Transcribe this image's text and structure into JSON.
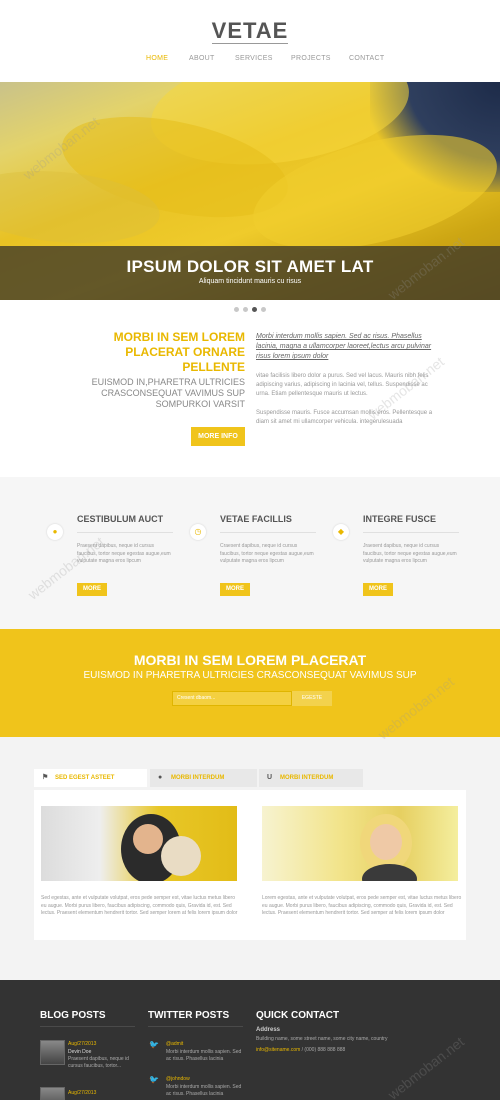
{
  "header": {
    "logo": "VETAE",
    "nav": [
      {
        "label": "HOME",
        "active": true
      },
      {
        "label": "ABOUT",
        "active": false
      },
      {
        "label": "SERVICES",
        "active": false
      },
      {
        "label": "PROJECTS",
        "active": false
      },
      {
        "label": "CONTACT",
        "active": false
      }
    ]
  },
  "hero": {
    "title": "IPSUM DOLOR SIT AMET LAT",
    "subtitle": "Aliquam tincidunt mauris cu risus",
    "slides": 4,
    "active_slide": 2
  },
  "intro": {
    "title": "MORBI IN SEM LOREM PLACERAT ORNARE PELLENTE",
    "subtitle": "EUISMOD IN,PHARETRA ULTRICIES CRASCONSEQUAT VAVIMUS SUP SOMPURKOI VARSIT",
    "button": "MORE INFO",
    "italic_text": "Morbi interdum mollis sapien. Sed ac risus. Phasellus lacinia, magna a ullamcorper laoreet,lectus arcu pulvinar risus lorem ipsum dolor",
    "paragraph1": "vitae facilisis libero dolor a purus. Sed vel lacus. Mauris nibh felis adipiscing varius, adipiscing in lacinia vel, tellus. Suspendisse ac urna. Etiam pellentesque mauris ut lectus.",
    "paragraph2": "Suspendisse mauris. Fusce accumsan mollis eros. Pellentesque a diam sit amet mi ullamcorper vehicula. integerulesuada"
  },
  "features": [
    {
      "icon": "user-icon",
      "glyph": "●",
      "title": "CESTIBULUM AUCT",
      "text": "Praesent dapibus, neque id cursus faucibus, tortor neque egestas augue,eum vulputate magna eros lipcum",
      "button": "MORE"
    },
    {
      "icon": "clock-icon",
      "glyph": "◷",
      "title": "VETAE FACILLIS",
      "text": "Craesent dapibus, neque id cursus faucibus, tortor neque egestas augue,eum vulputate magna eros lipcum",
      "button": "MORE"
    },
    {
      "icon": "tag-icon",
      "glyph": "◆",
      "title": "INTEGRE FUSCE",
      "text": "Jraesent dapibus, neque id cursus faucibus, tortor neque egestas augue,eum vulputate magna eros lipcum",
      "button": "MORE"
    }
  ],
  "cta": {
    "title": "MORBI IN SEM LOREM PLACERAT",
    "subtitle": "EUISMOD IN PHARETRA ULTRICIES CRASCONSEQUAT VAVIMUS SUP",
    "input_placeholder": "Cresent dbaom...",
    "button": "EGESTE"
  },
  "tabs": {
    "items": [
      {
        "icon": "flag-icon",
        "glyph": "⚑",
        "label": "SED EGEST ASTEET",
        "active": true
      },
      {
        "icon": "drop-icon",
        "glyph": "●",
        "label": "MORBI INTERDUM",
        "active": false
      },
      {
        "icon": "magnet-icon",
        "glyph": "U",
        "label": "MORBI INTERDUM",
        "active": false
      }
    ],
    "text_left": "Sed egestas, ante et vulputate volutpat, eros pede semper est, vitae luctus metus libero eu augue. Morbi purus libero, faucibus adipiscing, commodo quis, Gravida id, est. Sed lectus. Praesent elementum hendrerit tortor. Sed semper lorem at felis lorem ipsum dolor",
    "text_right": "Lorem egestas, ante et vulputate volutpat, eros pede semper est, vitae luctus metus libero eu augue. Morbi purus libero, faucibus adipiscing, commodo quis, Gravida id, est. Sed lectus. Praesent elementum hendrerit tortor. Sed semper at felis lorem ipsum dolor"
  },
  "footer": {
    "blog": {
      "heading": "BLOG POSTS",
      "posts": [
        {
          "date": "Aug/27/2013",
          "author": "Devin Doe",
          "text": "Praesent dapibus, neque id cursus faucibus, tortor..."
        },
        {
          "date": "Aug/27/2013"
        }
      ]
    },
    "twitter": {
      "heading": "TWITTER POSTS",
      "tweets": [
        {
          "handle": "@admit",
          "text": "Morbi interdum mollis sapien. Sed ac risus. Phasellus lacinia"
        },
        {
          "handle": "@johndow",
          "text": "Morbi interdum mollis sapien. Sed ac risus. Phasellus lacinia"
        }
      ]
    },
    "contact": {
      "heading": "QUICK CONTACT",
      "address_label": "Address",
      "address": "Building name, some street name, some city name, country",
      "email": "info@sitename.com",
      "phone": "/ (000) 888 888 888"
    }
  },
  "watermark": "webmoban.net",
  "colors": {
    "accent": "#f0c41b",
    "dark": "#333333",
    "light_bg": "#f6f6f6"
  }
}
